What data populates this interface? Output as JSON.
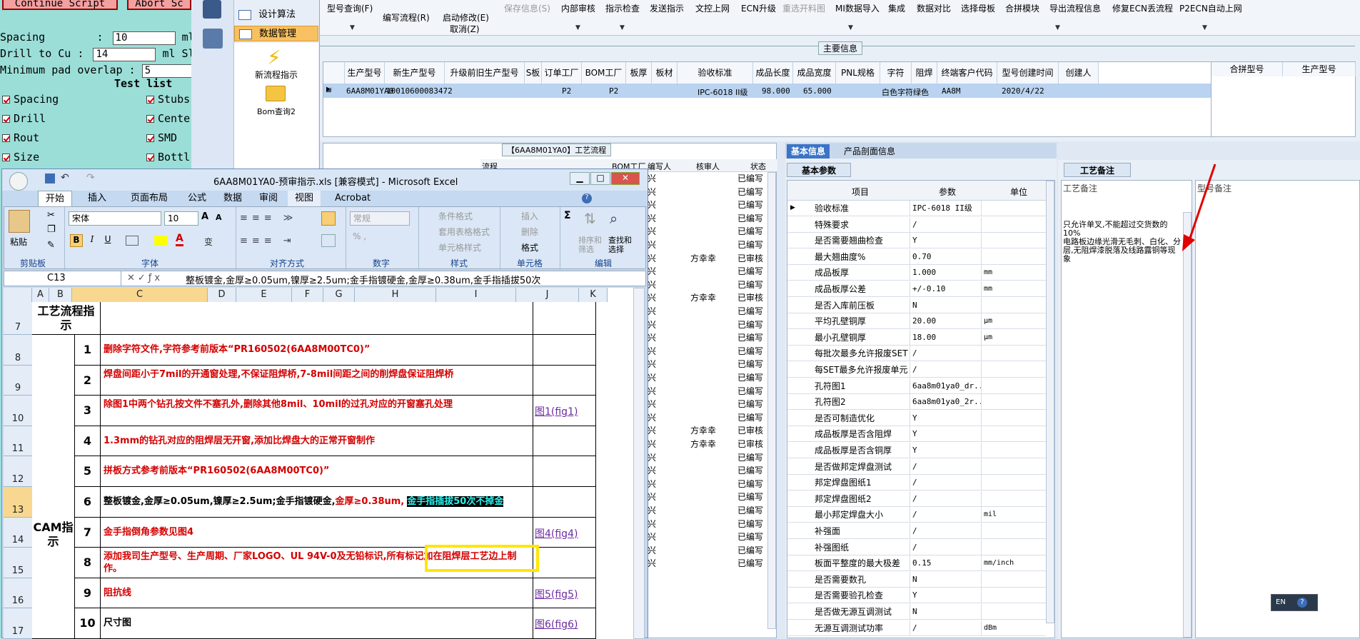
{
  "teal_panel": {
    "continue_btn": "Continue Script",
    "abort_btn": "Abort Sc",
    "spacing_label": "Spacing        :",
    "spacing_val": "10",
    "spacing_unit": "ml Ro",
    "drill_label": "Drill to Cu :",
    "drill_val": "14",
    "drill_unit": "ml Sl",
    "overlap_label": "Minimum pad overlap :",
    "overlap_val": "5",
    "test_list": "Test list",
    "checks": [
      "Spacing",
      "Stubs",
      "Drill",
      "Cente",
      "Rout",
      "SMD",
      "Size",
      "Bottl"
    ]
  },
  "nav": {
    "items": [
      "设计算法",
      "数据管理"
    ],
    "new_flow": "新流程指示",
    "bom_query": "Bom查询2"
  },
  "toolbar": {
    "items": [
      "型号查询(F)",
      "编写流程(R)",
      "启动修改(E)",
      "保存信息(S)",
      "内部审核",
      "指示检查",
      "发送指示",
      "文控上网",
      "ECN升级",
      "重选开料图",
      "MI数据导入",
      "集成",
      "数据对比",
      "选择母板",
      "合拼模块",
      "导出流程信息",
      "修复ECN丢流程",
      "P2ECN自动上网"
    ],
    "cancel": "取消(Z)"
  },
  "main_info": {
    "title": "主要信息",
    "headers": [
      "生产型号",
      "新生产型号",
      "升级前旧生产型号",
      "S板",
      "订单工厂",
      "BOM工厂",
      "板厚",
      "板材",
      "验收标准",
      "成品长度",
      "成品宽度",
      "PNL规格",
      "字符",
      "阻焊",
      "终端客户代码",
      "型号创建时间",
      "创建人"
    ],
    "row": [
      "6AA8M01YA0",
      "10010600083472",
      "",
      "",
      "P2",
      "P2",
      "",
      "",
      "IPC-6018 II级",
      "98.000",
      "65.000",
      "",
      "白色字符",
      "绿色",
      "AA8M",
      "2020/4/22",
      ""
    ],
    "right_headers": [
      "合拼型号",
      "生产型号"
    ]
  },
  "process_panel": {
    "title": "【6AA8M01YA0】工艺流程",
    "headers": [
      "流程",
      "BOM工厂",
      "编写人",
      "核审人",
      "状态"
    ],
    "writers": [
      "兴",
      "兴",
      "兴",
      "兴",
      "兴",
      "兴",
      "兴",
      "兴",
      "兴",
      "兴",
      "兴",
      "兴",
      "兴",
      "兴",
      "兴",
      "兴",
      "兴",
      "兴",
      "兴",
      "兴",
      "兴",
      "兴",
      "兴",
      "兴",
      "兴",
      "兴",
      "兴",
      "兴",
      "兴",
      "兴"
    ],
    "reviewers": {
      "6": "方幸幸",
      "9": "方幸幸",
      "19": "方幸幸",
      "20": "方幸幸"
    },
    "statuses": [
      "已编写",
      "已编写",
      "已编写",
      "已编写",
      "已编写",
      "已编写",
      "已审核",
      "已编写",
      "已编写",
      "已审核",
      "已编写",
      "已编写",
      "已编写",
      "已编写",
      "已编写",
      "已编写",
      "已编写",
      "已编写",
      "已编写",
      "已审核",
      "已审核",
      "已编写",
      "已编写",
      "已编写",
      "已编写",
      "已编写",
      "已编写",
      "已编写",
      "已编写",
      "已编写"
    ]
  },
  "basic_info": {
    "tabs": [
      "基本信息",
      "产品剖面信息"
    ],
    "subtab": "基本参数",
    "headers": [
      "项目",
      "参数",
      "单位"
    ],
    "rows": [
      [
        "验收标准",
        "IPC-6018 II级",
        ""
      ],
      [
        "特殊要求",
        "/",
        ""
      ],
      [
        "是否需要翘曲检查",
        "Y",
        ""
      ],
      [
        "最大翘曲度%",
        "0.70",
        ""
      ],
      [
        "成品板厚",
        "1.000",
        "mm"
      ],
      [
        "成品板厚公差",
        "+/-0.10",
        "mm"
      ],
      [
        "是否入库前压板",
        "N",
        ""
      ],
      [
        "平均孔壁铜厚",
        "20.00",
        "μm"
      ],
      [
        "最小孔壁铜厚",
        "18.00",
        "μm"
      ],
      [
        "每批次最多允许报废SET",
        "/",
        ""
      ],
      [
        "每SET最多允许报废单元",
        "/",
        ""
      ],
      [
        "孔符图1",
        "6aa8m01ya0_dr...",
        ""
      ],
      [
        "孔符图2",
        "6aa8m01ya0_2r...",
        ""
      ],
      [
        "是否可制造优化",
        "Y",
        ""
      ],
      [
        "成品板厚是否含阻焊",
        "Y",
        ""
      ],
      [
        "成品板厚是否含铜厚",
        "Y",
        ""
      ],
      [
        "是否做邦定焊盘测试",
        "/",
        ""
      ],
      [
        "邦定焊盘图纸1",
        "/",
        ""
      ],
      [
        "邦定焊盘图纸2",
        "/",
        ""
      ],
      [
        "最小邦定焊盘大小",
        "/",
        "mil"
      ],
      [
        "补强面",
        "/",
        ""
      ],
      [
        "补强图纸",
        "/",
        ""
      ],
      [
        "板面平整度的最大极差",
        "0.15",
        "mm/inch"
      ],
      [
        "是否需要数孔",
        "N",
        ""
      ],
      [
        "是否需要验孔检查",
        "Y",
        ""
      ],
      [
        "是否做无源互调测试",
        "N",
        ""
      ],
      [
        "无源互调测试功率",
        "/",
        "dBm"
      ]
    ]
  },
  "remarks": {
    "tab": "工艺备注",
    "label": "工艺备注",
    "text": [
      "只允许单叉,不能超过交货数的10%",
      "电路板边缘光滑无毛刺、白化、分层,无阻焊漆脱落及线路露铜等现象"
    ],
    "model_remark": "型号备注"
  },
  "excel": {
    "title": "6AA8M01YA0-预审指示.xls  [兼容模式] - Microsoft Excel",
    "tabs": [
      "开始",
      "插入",
      "页面布局",
      "公式",
      "数据",
      "审阅",
      "视图",
      "Acrobat"
    ],
    "groups": [
      "剪贴板",
      "字体",
      "对齐方式",
      "数字",
      "样式",
      "单元格",
      "编辑"
    ],
    "font": "宋体",
    "font_size": "10",
    "number_format": "常规",
    "paste": "粘贴",
    "style_items": [
      "条件格式",
      "套用表格格式",
      "单元格样式"
    ],
    "cell_items": [
      "插入",
      "删除",
      "格式"
    ],
    "edit_items": [
      "排序和筛选",
      "查找和选择"
    ],
    "cell_ref": "C13",
    "formula": "整板镀金,金厚≥0.05um,镍厚≥2.5um;金手指镀硬金,金厚≥0.38um,金手指插拔50次",
    "columns": [
      "A",
      "B",
      "C",
      "D",
      "E",
      "F",
      "G",
      "H",
      "I",
      "J",
      "K"
    ],
    "row_numbers": [
      "7",
      "8",
      "9",
      "10",
      "11",
      "12",
      "13",
      "14",
      "15",
      "16",
      "17"
    ],
    "header_cell": "工艺流程指示",
    "cam_label": "CAM指示",
    "steps": [
      {
        "n": "1",
        "text": "删除字符文件,字符参考前版本“PR160502(6AA8M00TC0)”",
        "link": ""
      },
      {
        "n": "2",
        "text": "焊盘间距小于7mil的开通窗处理,不保证阻焊桥,7-8mil间距之间的削焊盘保证阻焊桥",
        "link": ""
      },
      {
        "n": "3",
        "text": "除图1中两个钻孔按文件不塞孔外,删除其他8mil、10mil的过孔对应的开窗塞孔处理",
        "link": "图1(fig1)"
      },
      {
        "n": "4",
        "text": "1.3mm的钻孔对应的阻焊层无开窗,添加比焊盘大的正常开窗制作",
        "link": ""
      },
      {
        "n": "5",
        "text": "拼板方式参考前版本“PR160502(6AA8M00TC0)”",
        "link": ""
      },
      {
        "n": "6",
        "text_black": "整板镀金,金厚≥0.05um,镍厚≥2.5um;金手指镀硬金,",
        "text_red": "金厚≥0.38um,",
        "text_hl": "金手指插拔50次不掉金",
        "link": ""
      },
      {
        "n": "7",
        "text": "金手指倒角参数见图4",
        "link": "图4(fig4)"
      },
      {
        "n": "8",
        "text": "添加我司生产型号、生产周期、厂家LOGO、UL 94V-0及无铅标识,所有标记加在阻焊层工艺边上制作。",
        "link": ""
      },
      {
        "n": "9",
        "text": "阻抗线",
        "link": "图5(fig5)"
      },
      {
        "n": "10",
        "text": "尺寸图",
        "link": "图6(fig6)"
      }
    ]
  },
  "tray": {
    "lang": "EN"
  }
}
